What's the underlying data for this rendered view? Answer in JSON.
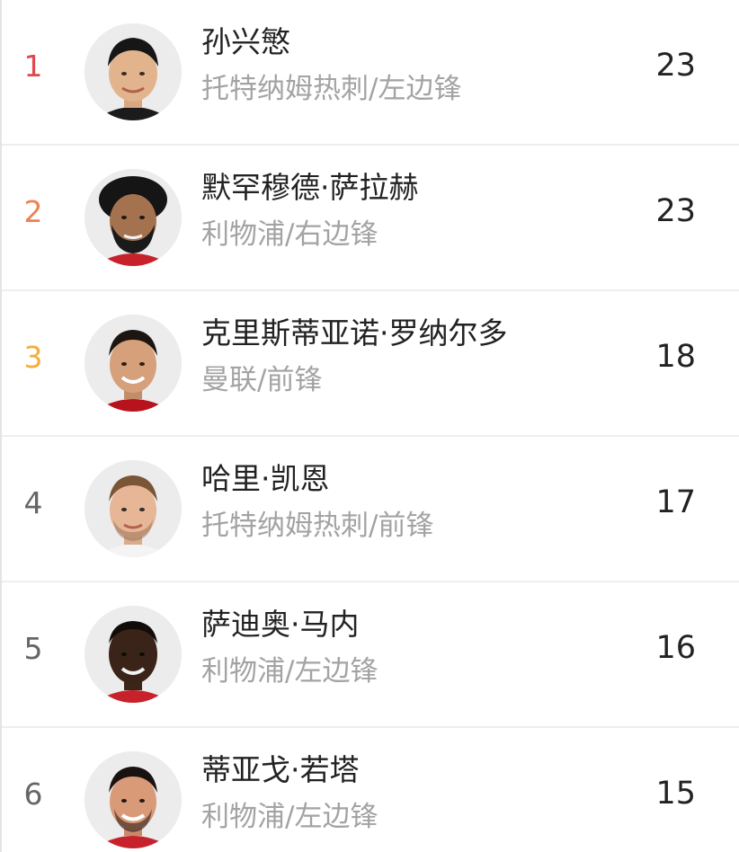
{
  "colors": {
    "rank_1": "#e0474f",
    "rank_2": "#ef8152",
    "rank_3": "#f3ad3a",
    "rank_default": "#666666",
    "name_text": "#222222",
    "meta_text": "#a3a3a3",
    "divider": "#eeeeee"
  },
  "players": [
    {
      "rank": "1",
      "name": "孙兴慜",
      "meta": "托特纳姆热刺/左边锋",
      "goals": "23",
      "avatar": "player-photo-son"
    },
    {
      "rank": "2",
      "name": "默罕穆德·萨拉赫",
      "meta": "利物浦/右边锋",
      "goals": "23",
      "avatar": "player-photo-salah"
    },
    {
      "rank": "3",
      "name": "克里斯蒂亚诺·罗纳尔多",
      "meta": "曼联/前锋",
      "goals": "18",
      "avatar": "player-photo-ronaldo"
    },
    {
      "rank": "4",
      "name": "哈里·凯恩",
      "meta": "托特纳姆热刺/前锋",
      "goals": "17",
      "avatar": "player-photo-kane"
    },
    {
      "rank": "5",
      "name": "萨迪奥·马内",
      "meta": "利物浦/左边锋",
      "goals": "16",
      "avatar": "player-photo-mane"
    },
    {
      "rank": "6",
      "name": "蒂亚戈·若塔",
      "meta": "利物浦/左边锋",
      "goals": "15",
      "avatar": "player-photo-jota"
    }
  ]
}
